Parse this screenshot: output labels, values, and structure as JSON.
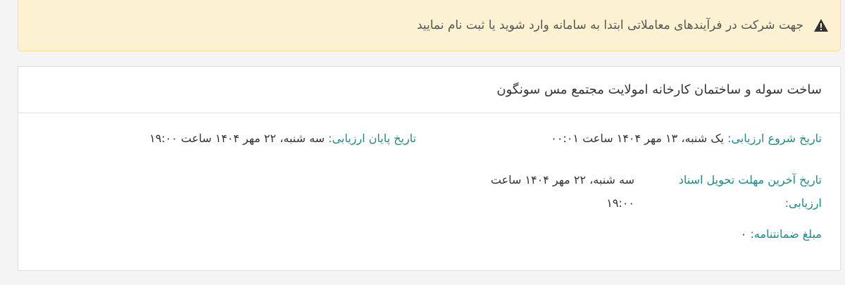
{
  "alert": {
    "icon": "warning-icon",
    "message": "جهت شرکت در فرآیندهای معاملاتی ابتدا به سامانه وارد شوید یا ثبت نام نمایید"
  },
  "panel": {
    "title": "ساخت سوله و ساختمان کارخانه امولایت مجتمع مس سونگون",
    "fields": {
      "start_label": "تاریخ شروع ارزیابی:",
      "start_value": "یک شنبه، ۱۳ مهر ۱۴۰۴ ساعت ۰۰:۰۱",
      "end_label": "تاریخ پایان ارزیابی:",
      "end_value": "سه شنبه، ۲۲ مهر ۱۴۰۴ ساعت ۱۹:۰۰",
      "deadline_label": "تاریخ آخرین مهلت تحویل اسناد ارزیابی:",
      "deadline_value": "سه شنبه، ۲۲ مهر ۱۴۰۴ ساعت ۱۹:۰۰",
      "guarantee_label": "مبلغ ضمانتنامه:",
      "guarantee_value": "۰"
    }
  },
  "colors": {
    "alert_bg": "#fcf2d1",
    "label": "#1a8b8b",
    "text": "#333333"
  }
}
